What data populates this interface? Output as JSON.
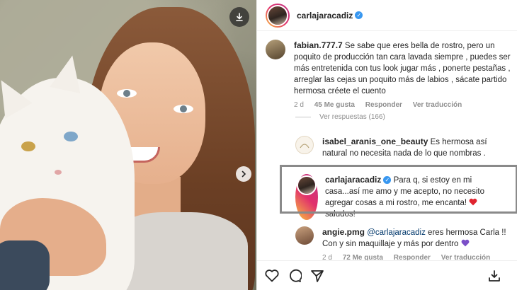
{
  "post": {
    "author": "carlajaracadiz",
    "verified": true
  },
  "photo": {
    "download_icon": "download-icon",
    "next_icon": "chevron-right-icon"
  },
  "comments": [
    {
      "user": "fabian.777.7",
      "text": "Se sabe que eres bella de rostro, pero un poquito de producción tan cara lavada siempre , puedes ser más entretenida con tus look jugar más , ponerte pestañas , arreglar las cejas un poquito más de labios , sácate partido hermosa créete el cuento",
      "time": "2 d",
      "likes": "45 Me gusta",
      "reply": "Responder",
      "translate": "Ver traducción",
      "view_replies": "Ver respuestas (166)"
    },
    {
      "user": "isabel_aranis_one_beauty",
      "text": "Es hermosa así natural no necesita nada de lo que nombras ."
    },
    {
      "user": "carlajaracadiz",
      "verified": true,
      "text": "Para q, si estoy en mi casa...así me amo y me acepto, no necesito agregar cosas a mi rostro, me encanta!",
      "text_end": "saludos!"
    },
    {
      "user": "angie.pmg",
      "mention": "@carlajaracadiz",
      "text": "eres hermosa Carla !! Con y sin maquillaje y más por dentro",
      "time": "2 d",
      "likes": "72 Me gusta",
      "reply": "Responder",
      "translate": "Ver traducción"
    }
  ],
  "actions": {
    "like_icon": "heart-icon",
    "comment_icon": "comment-icon",
    "share_icon": "share-icon",
    "save_icon": "save-icon"
  },
  "colors": {
    "verified": "#3897f0",
    "mention": "#00376b",
    "heart": "#e0242f",
    "purple_heart": "#7b4fc8",
    "highlight_border": "#8a8a8a"
  }
}
